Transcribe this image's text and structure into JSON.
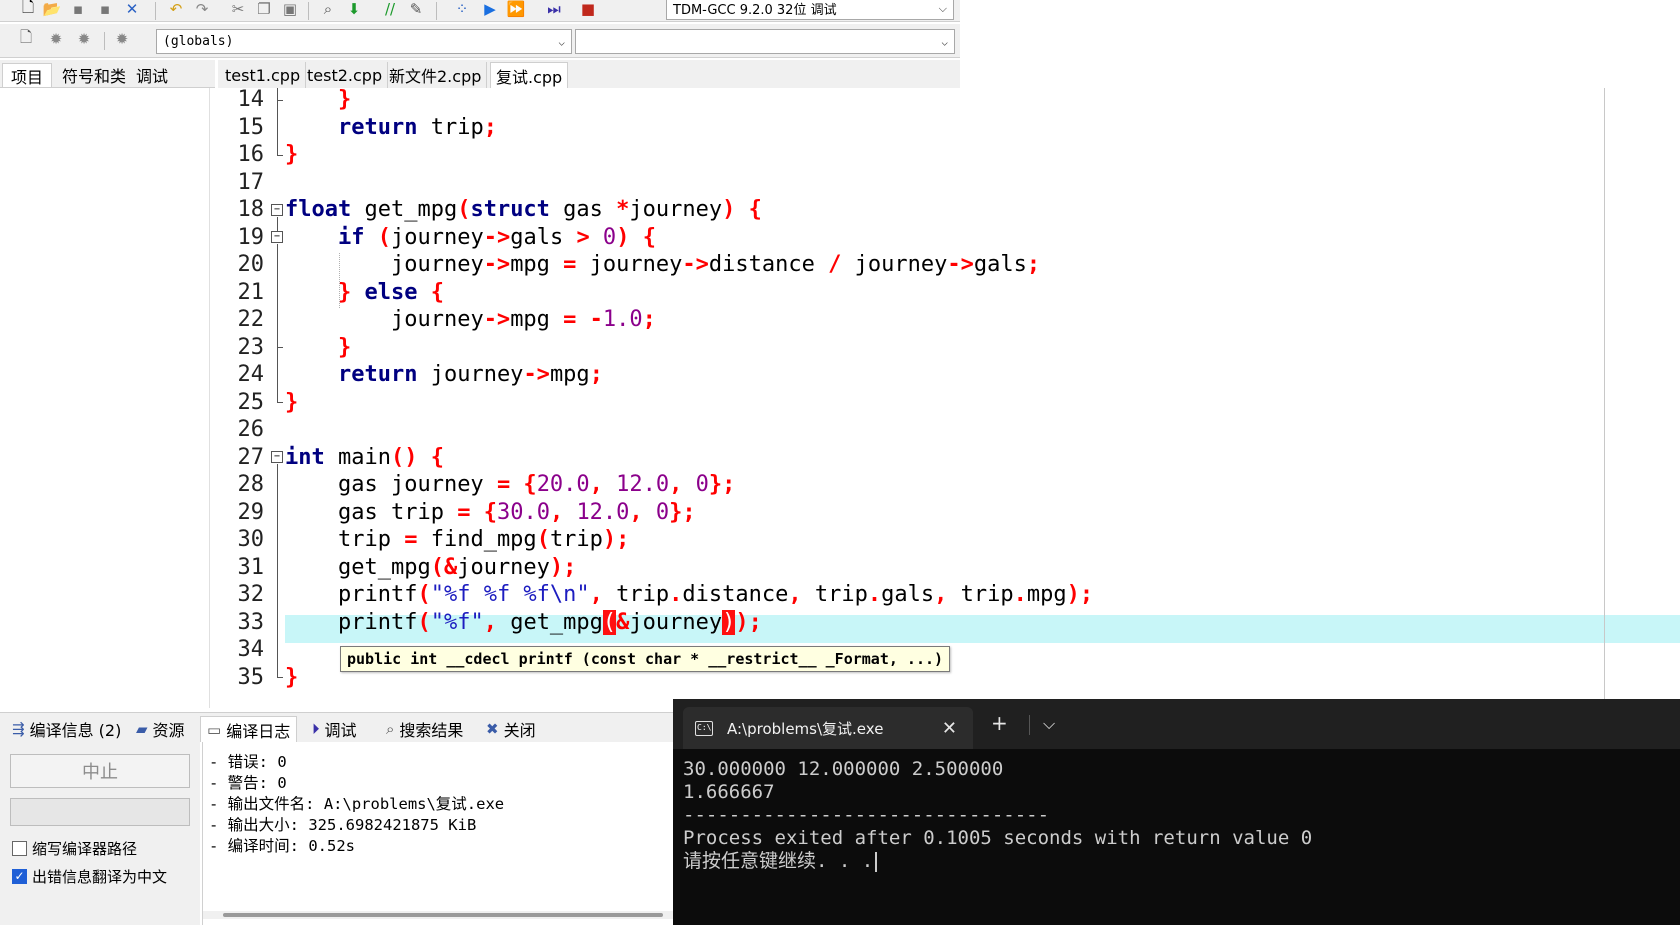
{
  "toolbar": {
    "compiler_select": "TDM-GCC 9.2.0 32位 调试",
    "scope_select": "(globals)",
    "member_select": ""
  },
  "left_tabs": [
    "项目",
    "符号和类",
    "调试"
  ],
  "file_tabs": [
    "test1.cpp",
    "test2.cpp",
    "新文件2.cpp",
    "复试.cpp"
  ],
  "editor": {
    "line_numbers": [
      "14",
      "15",
      "16",
      "17",
      "18",
      "19",
      "20",
      "21",
      "22",
      "23",
      "24",
      "25",
      "26",
      "27",
      "28",
      "29",
      "30",
      "31",
      "32",
      "33",
      "34",
      "35"
    ],
    "tooltip": "public int __cdecl printf (const char * __restrict__ _Format, ...)"
  },
  "code": {
    "l14": {
      "brace": "}"
    },
    "l15": {
      "kw": "return",
      "rest": " trip",
      "semi": ";"
    },
    "l16": {
      "brace": "}"
    },
    "l18": {
      "kw1": "float",
      "name": " get_mpg",
      "p1": "(",
      "kw2": "struct",
      "mid": " gas ",
      "star": "*",
      "arg": "journey",
      "p2": ")",
      "b": "{"
    },
    "l19": {
      "kw": "if",
      "p1": "(",
      "a": "journey",
      "arrow": "->",
      "b": "gals ",
      "gt": ">",
      "num": " 0",
      "p2": ")",
      "br": "{"
    },
    "l20": {
      "a": "journey",
      "ar1": "->",
      "b": "mpg ",
      "eq": "=",
      "c": " journey",
      "ar2": "->",
      "d": "distance ",
      "div": "/",
      "e": " journey",
      "ar3": "->",
      "f": "gals",
      "semi": ";"
    },
    "l21": {
      "b1": "}",
      "kw": "else",
      "b2": "{"
    },
    "l22": {
      "a": "journey",
      "ar": "->",
      "b": "mpg ",
      "eq": "=",
      "neg": " -",
      "num": "1.0",
      "semi": ";"
    },
    "l23": {
      "brace": "}"
    },
    "l24": {
      "kw": "return",
      "a": " journey",
      "ar": "->",
      "b": "mpg",
      "semi": ";"
    },
    "l25": {
      "brace": "}"
    },
    "l27": {
      "kw": "int",
      "name": " main",
      "p": "()",
      "b": "{"
    },
    "l28": {
      "a": "gas journey ",
      "eq": "=",
      "lb": " {",
      "n1": "20.0",
      "c1": ", ",
      "n2": "12.0",
      "c2": ", ",
      "n3": "0",
      "rb": "};"
    },
    "l29": {
      "a": "gas trip ",
      "eq": "=",
      "lb": " {",
      "n1": "30.0",
      "c1": ", ",
      "n2": "12.0",
      "c2": ", ",
      "n3": "0",
      "rb": "};"
    },
    "l30": {
      "a": "trip ",
      "eq": "=",
      "b": " find_mpg",
      "p1": "(",
      "c": "trip",
      "p2": ");"
    },
    "l31": {
      "a": "get_mpg",
      "p1": "(",
      "amp": "&",
      "b": "journey",
      "p2": ");"
    },
    "l32": {
      "a": "printf",
      "p1": "(",
      "s": "\"%f %f %f\\n\"",
      "c1": ",",
      "b": " trip",
      "d1": ".",
      "c": "distance",
      "c2": ",",
      "d": " trip",
      "d2": ".",
      "e": "gals",
      "c3": ",",
      "f": " trip",
      "d3": ".",
      "g": "mpg",
      "p2": ");"
    },
    "l33": {
      "a": "printf",
      "p1": "(",
      "s": "\"%f\"",
      "c1": ",",
      "b": " get_mpg",
      "p2": "(",
      "amp": "&",
      "c": "journey",
      "p3": ")",
      "end": ");"
    },
    "l35": {
      "brace": "}"
    }
  },
  "bottom_tabs": [
    "编译信息 (2)",
    "资源",
    "编译日志",
    "调试",
    "搜索结果",
    "关闭"
  ],
  "bottom_panel": {
    "stop_button": "中止",
    "check1": "缩写编译器路径",
    "check1_checked": false,
    "check2": "出错信息翻译为中文",
    "check2_checked": true
  },
  "compile_log": [
    "- 错误: 0",
    "- 警告: 0",
    "- 输出文件名: A:\\problems\\复试.exe",
    "- 输出大小: 325.6982421875 KiB",
    "- 编译时间: 0.52s"
  ],
  "terminal": {
    "title": "A:\\problems\\复试.exe",
    "lines": [
      "30.000000 12.000000 2.500000",
      "1.666667",
      "--------------------------------",
      "Process exited after 0.1005 seconds with return value 0",
      "请按任意键继续. . ."
    ]
  },
  "colors": {
    "keyword": "#000080",
    "symbol": "#ff0000",
    "number": "#8b008b",
    "string": "#1d1dc0",
    "current_line": "#c8f6f8",
    "brace_match": "#ff1010",
    "terminal_bg": "#0c0c0c"
  }
}
